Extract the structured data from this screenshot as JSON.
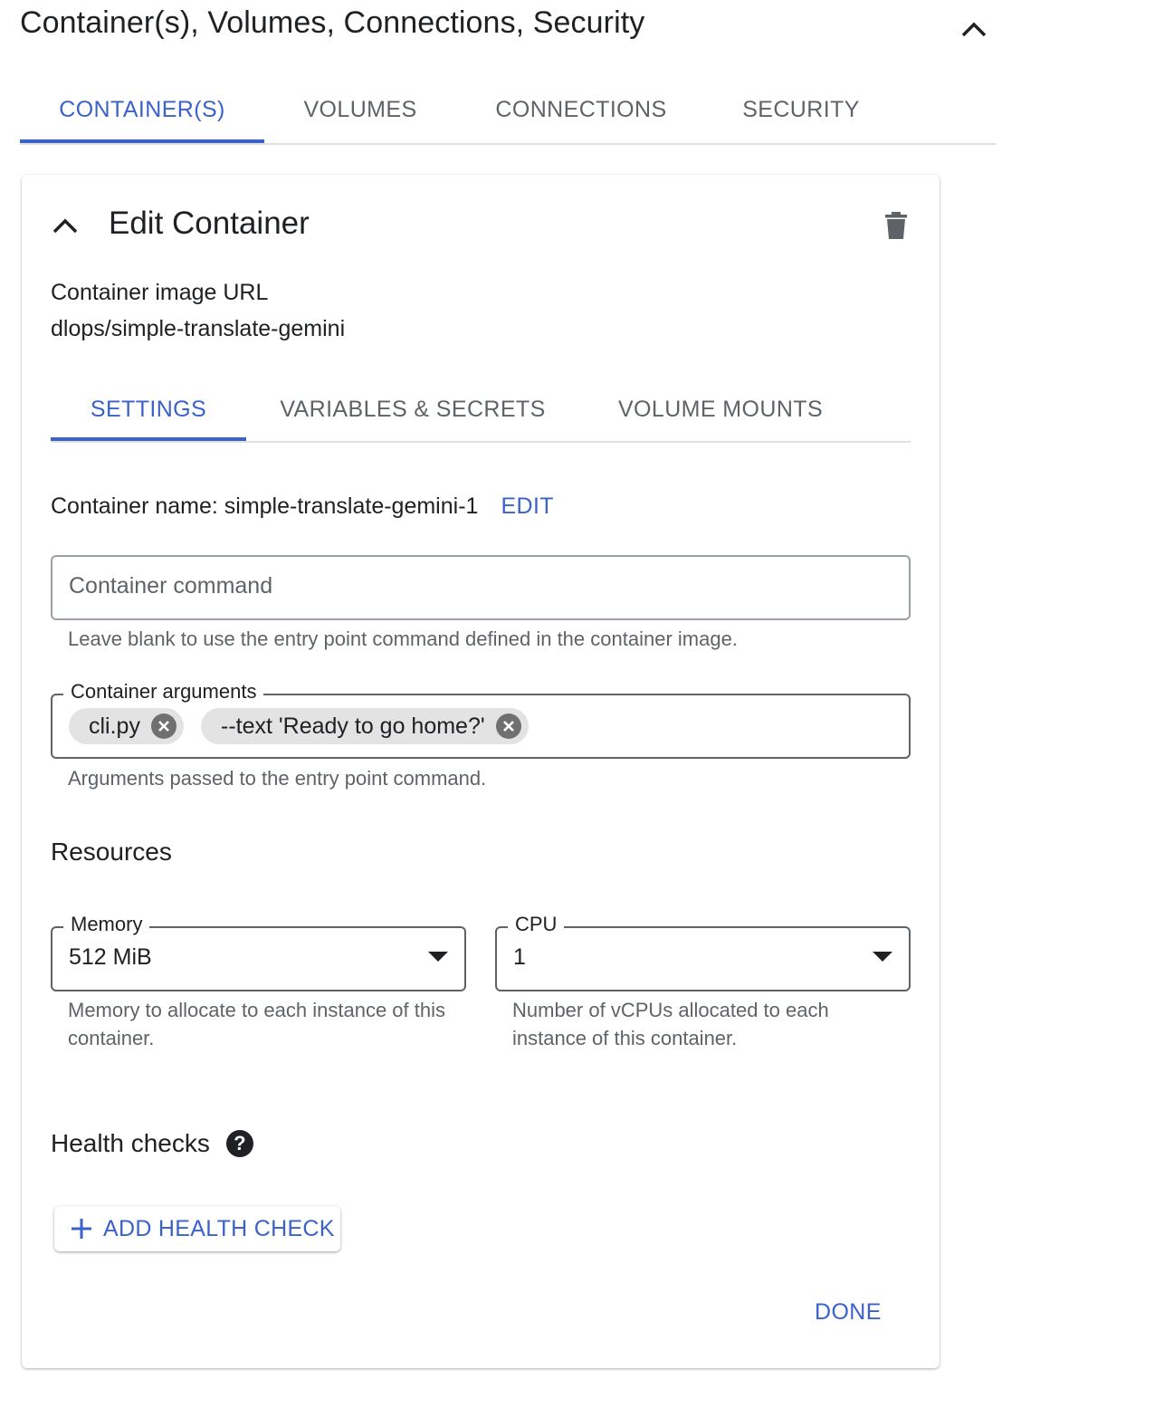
{
  "section": {
    "title": "Container(s), Volumes, Connections, Security"
  },
  "top_tabs": [
    {
      "label": "CONTAINER(S)",
      "active": true
    },
    {
      "label": "VOLUMES",
      "active": false
    },
    {
      "label": "CONNECTIONS",
      "active": false
    },
    {
      "label": "SECURITY",
      "active": false
    }
  ],
  "card": {
    "title": "Edit Container",
    "image_url_label": "Container image URL",
    "image_url_value": "dlops/simple-translate-gemini"
  },
  "inner_tabs": [
    {
      "label": "SETTINGS",
      "active": true
    },
    {
      "label": "VARIABLES & SECRETS",
      "active": false
    },
    {
      "label": "VOLUME MOUNTS",
      "active": false
    }
  ],
  "settings": {
    "container_name_text": "Container name: simple-translate-gemini-1",
    "edit_label": "EDIT",
    "command": {
      "placeholder": "Container command",
      "hint": "Leave blank to use the entry point command defined in the container image."
    },
    "arguments": {
      "label": "Container arguments",
      "chips": [
        "cli.py",
        "--text 'Ready to go home?'"
      ],
      "hint": "Arguments passed to the entry point command."
    },
    "resources": {
      "title": "Resources",
      "memory": {
        "label": "Memory",
        "value": "512 MiB",
        "hint": "Memory to allocate to each instance of this container."
      },
      "cpu": {
        "label": "CPU",
        "value": "1",
        "hint": "Number of vCPUs allocated to each instance of this container."
      }
    },
    "health": {
      "title": "Health checks",
      "help_glyph": "?",
      "add_button_label": "ADD HEALTH CHECK"
    },
    "done_label": "DONE"
  },
  "colors": {
    "accent": "#3b62c9",
    "text": "#202124",
    "muted": "#5f6368",
    "chip_bg": "#e3e3e3",
    "divider": "#e0e0e0"
  },
  "icons": {
    "section_collapse": "chevron-up-icon",
    "card_collapse": "chevron-up-icon",
    "delete": "trash-icon",
    "chip_remove": "close-circle-icon",
    "select": "arrow-drop-down-icon",
    "help": "help-circle-icon",
    "add": "plus-icon"
  }
}
